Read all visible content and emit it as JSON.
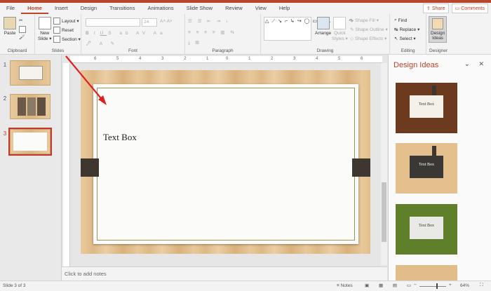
{
  "tabs": [
    "File",
    "Home",
    "Insert",
    "Design",
    "Transitions",
    "Animations",
    "Slide Show",
    "Review",
    "View",
    "Help"
  ],
  "active_tab": "Home",
  "share_label": "Share",
  "comments_label": "Comments",
  "ribbon": {
    "clipboard": {
      "label": "Clipboard",
      "paste": "Paste"
    },
    "slides": {
      "label": "Slides",
      "new_slide": "New",
      "new_slide2": "Slide ▾",
      "layout": "Layout ▾",
      "reset": "Reset",
      "section": "Section ▾"
    },
    "font": {
      "label": "Font",
      "size": "24"
    },
    "paragraph": {
      "label": "Paragraph"
    },
    "drawing": {
      "label": "Drawing",
      "arrange": "Arrange",
      "quick_styles": "Quick",
      "quick_styles2": "Styles ▾",
      "shape_fill": "Shape Fill ▾",
      "shape_outline": "Shape Outline ▾",
      "shape_effects": "Shape Effects ▾"
    },
    "editing": {
      "label": "Editing",
      "find": "Find",
      "replace": "Replace ▾",
      "select": "Select ▾"
    },
    "designer": {
      "label": "Designer",
      "design_ideas": "Design",
      "design_ideas2": "Ideas"
    }
  },
  "thumbnails": [
    {
      "num": "1"
    },
    {
      "num": "2"
    },
    {
      "num": "3"
    }
  ],
  "ruler_numbers": [
    "6",
    "5",
    "4",
    "3",
    "2",
    "1",
    "0",
    "1",
    "2",
    "3",
    "4",
    "5",
    "6"
  ],
  "slide": {
    "text_box": "Text Box"
  },
  "notes_placeholder": "Click to add notes",
  "design_ideas": {
    "title": "Design Ideas",
    "ideas": [
      {
        "label": "Text Box",
        "bg": "#6b3a1f",
        "card": "#f4f1e8",
        "text": "#333"
      },
      {
        "label": "Text Box",
        "bg": "#e3c08e",
        "card": "#3a3834",
        "text": "#fff"
      },
      {
        "label": "Text Box",
        "bg": "#5f7f2a",
        "card": "#e9e9e6",
        "text": "#333"
      }
    ]
  },
  "status": {
    "slide": "Slide 3 of 3",
    "notes": "Notes",
    "zoom": "64%"
  }
}
